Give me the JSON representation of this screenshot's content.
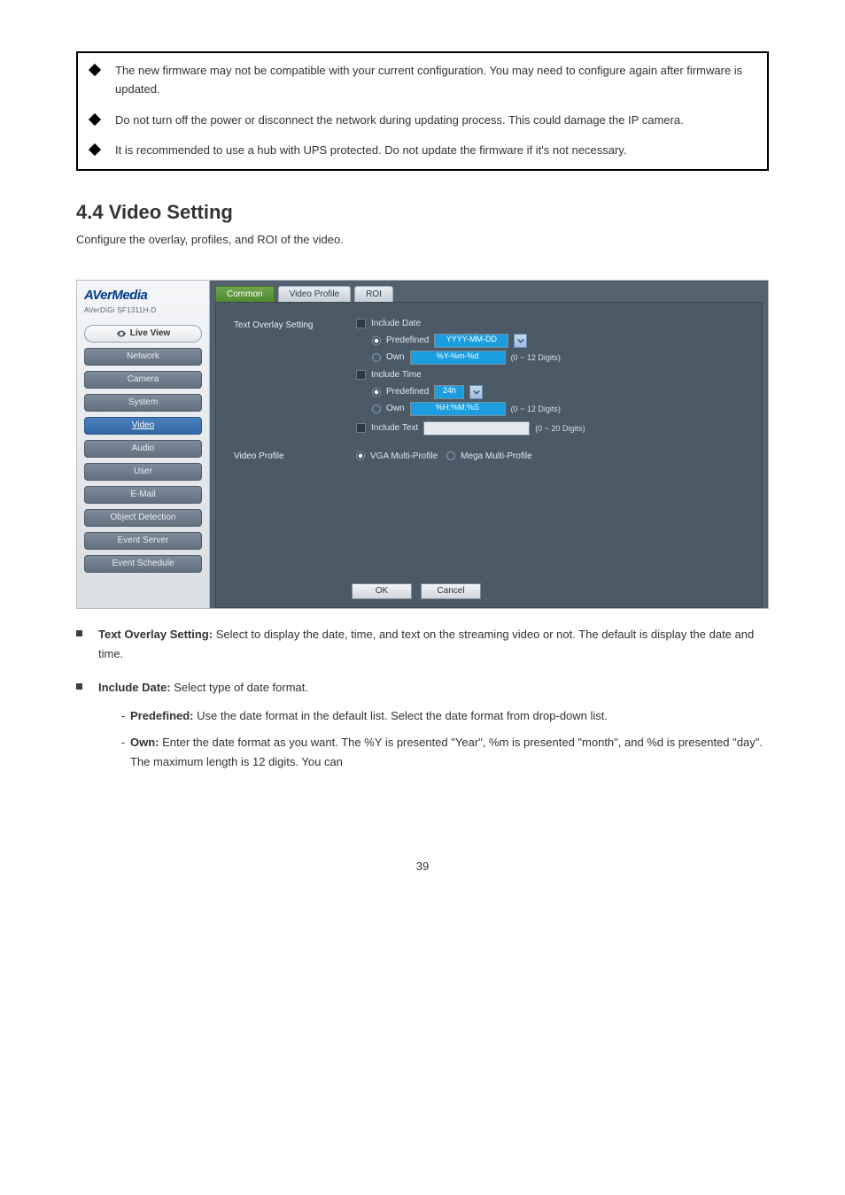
{
  "frame": {
    "bullets": [
      "The new firmware may not be compatible with your current configuration. You may need to configure again after firmware is updated.",
      "Do not turn off the power or disconnect the network during updating process. This could damage the IP camera.",
      "It is recommended to use a hub with UPS protected. Do not update the firmware if it's not necessary."
    ]
  },
  "section": {
    "title": "4.4 Video Setting",
    "desc": "Configure the overlay, profiles, and ROI of the video."
  },
  "ui": {
    "logo": "AVerMedia",
    "logo_sub": "AVerDiGi SF1311H-D",
    "live_view": "Live View",
    "nav": [
      "Network",
      "Camera",
      "System",
      "Video",
      "Audio",
      "User",
      "E-Mail",
      "Object Detection",
      "Event Server",
      "Event Schedule"
    ],
    "active_nav": "Video",
    "tabs": [
      "Common",
      "Video Profile",
      "ROI"
    ],
    "active_tab": "Common",
    "labels": {
      "text_overlay": "Text Overlay Setting",
      "include_date": "Include Date",
      "include_time": "Include Time",
      "include_text": "Include Text",
      "predefined": "Predefined",
      "own": "Own",
      "date_predef_val": "YYYY-MM-DD",
      "date_own_val": "%Y-%m-%d",
      "date_hint": "(0 ~ 12 Digits)",
      "time_predef_val": "24h",
      "time_own_val": "%H:%M:%S",
      "time_hint": "(0 ~ 12 Digits)",
      "text_hint": "(0 ~ 20 Digits)",
      "video_profile": "Video Profile",
      "vga": "VGA Multi-Profile",
      "mega": "Mega Multi-Profile"
    },
    "buttons": {
      "ok": "OK",
      "cancel": "Cancel"
    }
  },
  "lower": {
    "text_overlay_title": "Text Overlay Setting:",
    "text_overlay_desc": " Select to display the date, time, and text on the streaming video or not. The default is display the date and time.",
    "include_date_title": "Include Date:",
    "include_date_desc": " Select type of date format.",
    "hyphens": [
      {
        "title": "Predefined:",
        "text": " Use the date format in the default list. Select the date format from drop-down list."
      },
      {
        "title": "Own:",
        "text": " Enter the date format as you want. The %Y is presented \"Year\", %m is presented \"month\", and %d is presented \"day\". The maximum length is 12 digits. You can"
      }
    ]
  },
  "footer": "39"
}
